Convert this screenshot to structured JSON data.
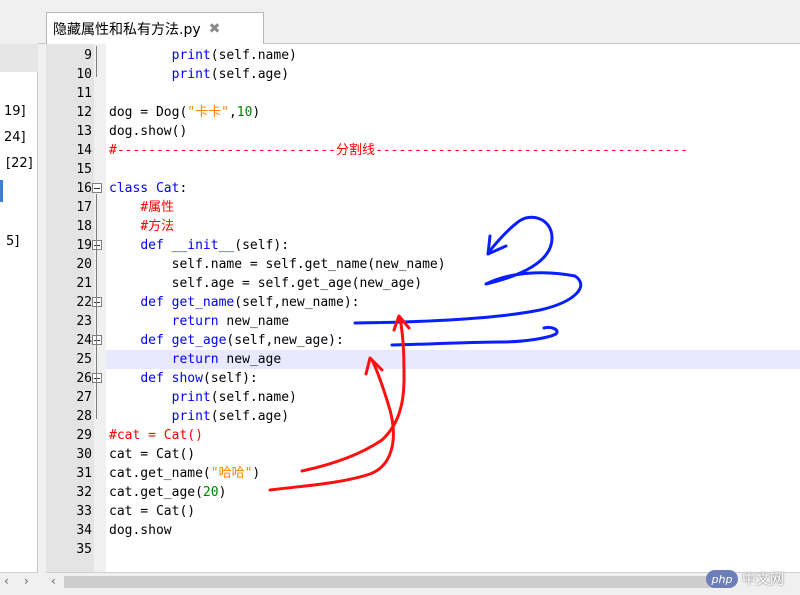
{
  "tab": {
    "title": "隐藏属性和私有方法.py",
    "close_icon": "✖"
  },
  "left_fragments": [
    "19]",
    "24]",
    "[22]",
    "5]"
  ],
  "code_lines": [
    {
      "n": "9",
      "html": "        <span class='kw'>print</span>(self.name)"
    },
    {
      "n": "10",
      "html": "        <span class='kw'>print</span>(self.age)"
    },
    {
      "n": "11",
      "html": ""
    },
    {
      "n": "12",
      "html": "dog = Dog(<span class='str'>\"卡卡\"</span>,<span class='num'>10</span>)"
    },
    {
      "n": "13",
      "html": "dog.show()"
    },
    {
      "n": "14",
      "html": "<span class='cmt'>#----------------------------分割线----------------------------------------</span>"
    },
    {
      "n": "15",
      "html": ""
    },
    {
      "n": "16",
      "html": "<span class='kw'>class</span> <span class='kw'>Cat</span>:"
    },
    {
      "n": "17",
      "html": "    <span class='cmt'>#属性</span>"
    },
    {
      "n": "18",
      "html": "    <span class='cmt'>#方法</span>"
    },
    {
      "n": "19",
      "html": "    <span class='kw'>def</span> <span class='kw'>__init__</span>(self):"
    },
    {
      "n": "20",
      "html": "        self.name = self.get_name(new_name)"
    },
    {
      "n": "21",
      "html": "        self.age = self.get_age(new_age)"
    },
    {
      "n": "22",
      "html": "    <span class='kw'>def</span> <span class='kw'>get_name</span>(self,new_name):"
    },
    {
      "n": "23",
      "html": "        <span class='kw'>return</span> new_name"
    },
    {
      "n": "24",
      "html": "    <span class='kw'>def</span> <span class='kw'>get_age</span>(self,new_age):"
    },
    {
      "n": "25",
      "html": "        <span class='kw'>return</span> new_age"
    },
    {
      "n": "26",
      "html": "    <span class='kw'>def</span> <span class='kw'>show</span>(self):"
    },
    {
      "n": "27",
      "html": "        <span class='kw'>print</span>(self.name)"
    },
    {
      "n": "28",
      "html": "        <span class='kw'>print</span>(self.age)"
    },
    {
      "n": "29",
      "html": "<span class='cmt'>#cat = Cat()</span>"
    },
    {
      "n": "30",
      "html": "cat = Cat()"
    },
    {
      "n": "31",
      "html": "cat.get_name(<span class='str'>\"哈哈\"</span>)"
    },
    {
      "n": "32",
      "html": "cat.get_age(<span class='num'>20</span>)"
    },
    {
      "n": "33",
      "html": "cat = Cat()"
    },
    {
      "n": "34",
      "html": "dog.show"
    },
    {
      "n": "35",
      "html": ""
    }
  ],
  "current_line": "25",
  "scroll": {
    "left_arrow": "‹",
    "right_arrow": "›"
  },
  "watermark": {
    "logo": "php",
    "text": "中文网"
  },
  "colors": {
    "annotation_blue": "#0a1fff",
    "annotation_red": "#ff1010",
    "keyword": "#0000ff",
    "string": "#ff8000",
    "number": "#008000",
    "comment": "#ff0000"
  }
}
